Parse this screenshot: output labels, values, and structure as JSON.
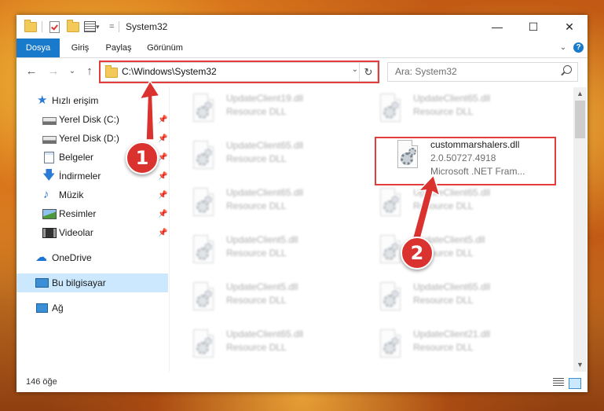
{
  "window": {
    "title": "System32",
    "minimize": "—",
    "maximize": "☐",
    "close": "✕"
  },
  "ribbon": {
    "tabs": [
      "Dosya",
      "Giriş",
      "Paylaş",
      "Görünüm"
    ],
    "expand": "⌄",
    "help": "?"
  },
  "nav": {
    "back": "←",
    "forward": "→",
    "recent": "⌄",
    "up": "↑",
    "address": "C:\\Windows\\System32",
    "address_dropdown": "⌄",
    "refresh": "↻",
    "search_placeholder": "Ara: System32"
  },
  "sidebar": {
    "items": [
      {
        "label": "Hızlı erişim",
        "icon": "star-icon"
      },
      {
        "label": "Yerel Disk (C:)",
        "icon": "drive-icon",
        "pinned": true
      },
      {
        "label": "Yerel Disk (D:)",
        "icon": "drive-icon",
        "pinned": true
      },
      {
        "label": "Belgeler",
        "icon": "documents-icon",
        "pinned": true
      },
      {
        "label": "İndirmeler",
        "icon": "download-icon",
        "pinned": true
      },
      {
        "label": "Müzik",
        "icon": "music-icon",
        "pinned": true
      },
      {
        "label": "Resimler",
        "icon": "pictures-icon",
        "pinned": true
      },
      {
        "label": "Videolar",
        "icon": "video-icon",
        "pinned": true
      },
      {
        "label": "OneDrive",
        "icon": "cloud-icon"
      },
      {
        "label": "Bu bilgisayar",
        "icon": "computer-icon",
        "selected": true
      },
      {
        "label": "Ağ",
        "icon": "network-icon"
      }
    ],
    "pin_glyph": "📌"
  },
  "files": [
    {
      "name": "UpdateClient19.dll",
      "type": "Resource DLL"
    },
    {
      "name": "UpdateClient65.dll",
      "type": "Resource DLL"
    },
    {
      "name": "UpdateClient65.dll",
      "type": "Resource DLL"
    },
    {
      "name": "custommarshalers.dll",
      "type": "2.0.50727.4918",
      "desc": "Microsoft .NET Fram...",
      "highlighted": true
    },
    {
      "name": "UpdateClient65.dll",
      "type": "Resource DLL"
    },
    {
      "name": "UpdateClient65.dll",
      "type": "Resource DLL"
    },
    {
      "name": "UpdateClient5.dll",
      "type": "Resource DLL"
    },
    {
      "name": "UpdateClient5.dll",
      "type": "Resource DLL"
    },
    {
      "name": "UpdateClient5.dll",
      "type": "Resource DLL"
    },
    {
      "name": "UpdateClient65.dll",
      "type": "Resource DLL"
    },
    {
      "name": "UpdateClient65.dll",
      "type": "Resource DLL"
    },
    {
      "name": "UpdateClient21.dll",
      "type": "Resource DLL"
    }
  ],
  "scrollbar": {
    "up": "▲",
    "down": "▼"
  },
  "status": {
    "count": "146 öğe"
  },
  "annotations": {
    "badge1": "1",
    "badge2": "2"
  },
  "colors": {
    "accent": "#1979ca",
    "highlight": "#e23c3c",
    "badge": "#d9322f",
    "selected": "#cce8ff"
  }
}
